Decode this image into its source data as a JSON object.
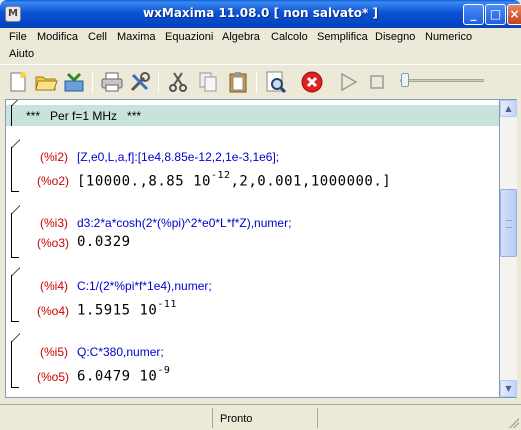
{
  "window": {
    "title": "wxMaxima 11.08.0 [ non salvato* ]",
    "app_icon": "M",
    "minimize": "_",
    "maximize": "□",
    "close": "×"
  },
  "menu": [
    "File",
    "Modifica",
    "Cell",
    "Maxima",
    "Equazioni",
    "Algebra",
    "Calcolo",
    "Semplifica",
    "Disegno",
    "Numerico",
    "Aiuto"
  ],
  "toolbar": {
    "icons": [
      "new-document-icon",
      "open-folder-icon",
      "save-icon",
      "print-icon",
      "settings-tools-icon",
      "cut-icon",
      "copy-icon",
      "paste-icon",
      "find-icon",
      "interrupt-icon",
      "play-icon",
      "stop-icon",
      "animation-slider"
    ],
    "slider_position": 0.0
  },
  "document": {
    "title_cell": "***   Per f=1 MHz   ***",
    "cells": [
      {
        "in_label": "(%i2)",
        "input": "[Z,e0,L,a,f]:[1e4,8.85e-12,2,1e-3,1e6];",
        "out_label": "(%o2)",
        "output_parts": [
          "[10000.,8.85 10",
          "-12",
          ",2,0.001,1000000.]"
        ]
      },
      {
        "in_label": "(%i3)",
        "input": "d3:2*a*cosh(2*(%pi)^2*e0*L*f*Z),numer;",
        "out_label": "(%o3)",
        "output_parts": [
          "0.0329",
          "",
          ""
        ]
      },
      {
        "in_label": "(%i4)",
        "input": "C:1/(2*%pi*f*1e4),numer;",
        "out_label": "(%o4)",
        "output_parts": [
          "1.5915 10",
          "-11",
          ""
        ]
      },
      {
        "in_label": "(%i5)",
        "input": "Q:C*380,numer;",
        "out_label": "(%o5)",
        "output_parts": [
          "6.0479 10",
          "-9",
          ""
        ]
      }
    ]
  },
  "status": {
    "text": "Pronto"
  },
  "colors": {
    "titlebar": "#0a54d4",
    "title_cell_bg": "#c8e2dc",
    "input_label": "#cc0000",
    "input_code": "#0000cc",
    "output_label": "#cc0000"
  }
}
